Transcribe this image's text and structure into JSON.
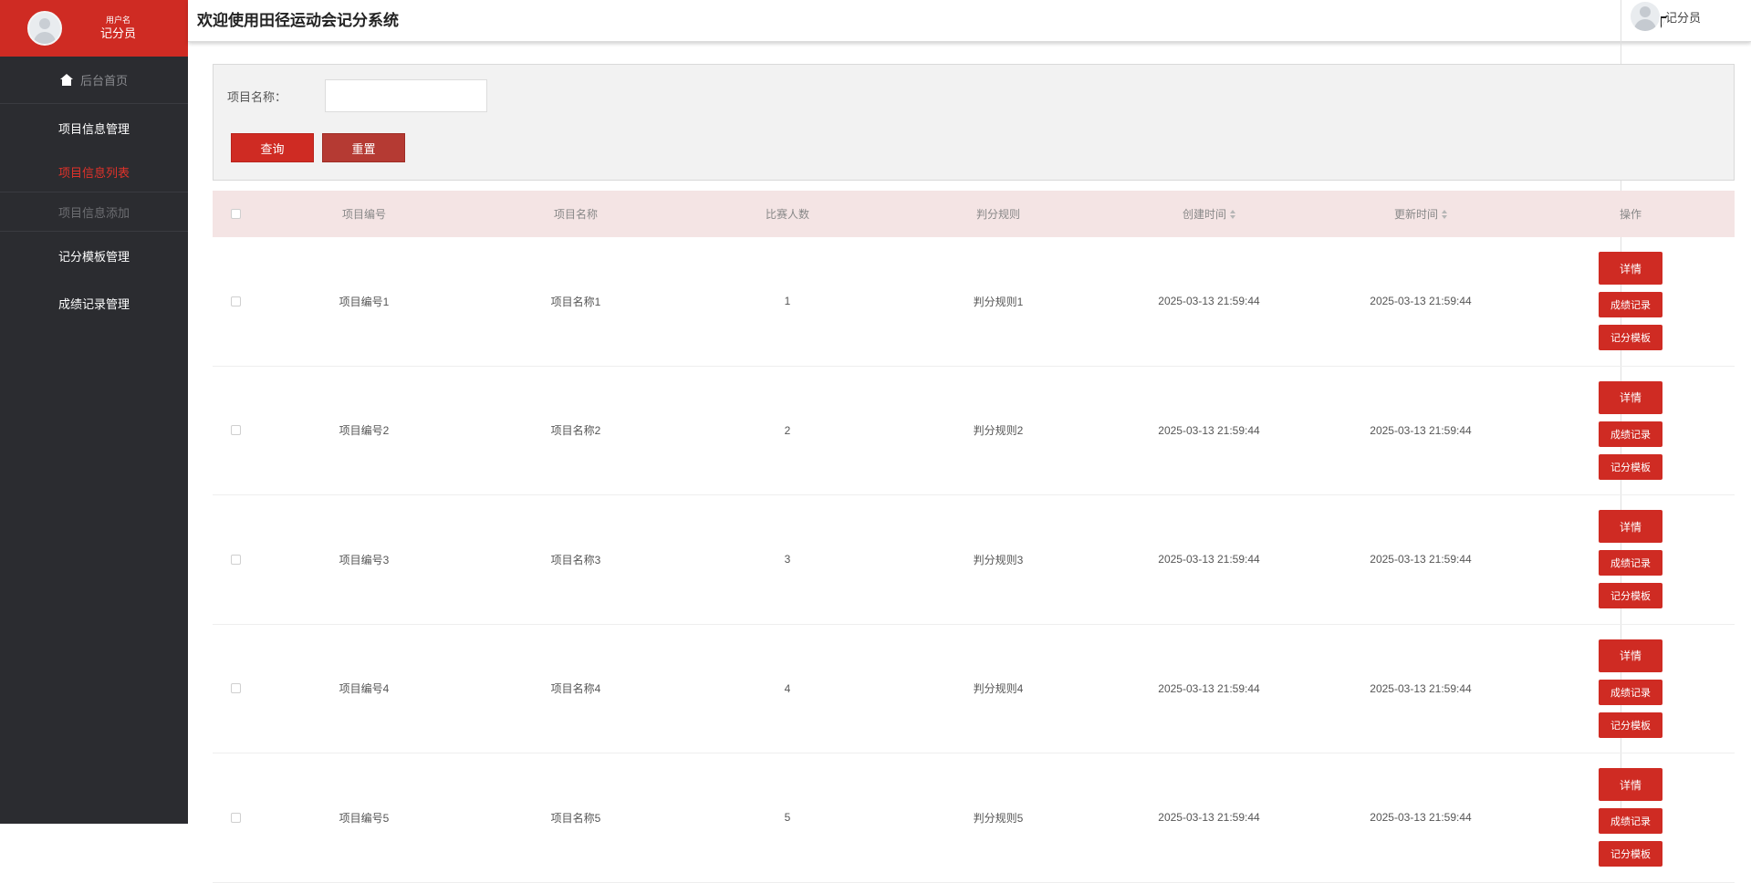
{
  "app": {
    "title": "欢迎使用田径运动会记分系统"
  },
  "sidebar": {
    "user_caption": "用户名",
    "user_role": "记分员",
    "home": "后台首页",
    "groups": [
      {
        "label": "项目信息管理",
        "items": [
          {
            "label": "项目信息列表",
            "active": true
          },
          {
            "label": "项目信息添加",
            "active": false
          }
        ]
      },
      {
        "label": "记分模板管理"
      },
      {
        "label": "成绩记录管理"
      }
    ]
  },
  "header": {
    "user_name": "记分员"
  },
  "search": {
    "label": "项目名称：",
    "value": "",
    "placeholder": "",
    "query_button": "查询",
    "reset_button": "重置"
  },
  "table": {
    "columns": [
      "项目编号",
      "项目名称",
      "比赛人数",
      "判分规则",
      "创建时间",
      "更新时间",
      "操作"
    ],
    "rows": [
      {
        "code": "项目编号1",
        "name": "项目名称1",
        "count": "1",
        "rule": "判分规则1",
        "created": "2025-03-13 21:59:44",
        "updated": "2025-03-13 21:59:44"
      },
      {
        "code": "项目编号2",
        "name": "项目名称2",
        "count": "2",
        "rule": "判分规则2",
        "created": "2025-03-13 21:59:44",
        "updated": "2025-03-13 21:59:44"
      },
      {
        "code": "项目编号3",
        "name": "项目名称3",
        "count": "3",
        "rule": "判分规则3",
        "created": "2025-03-13 21:59:44",
        "updated": "2025-03-13 21:59:44"
      },
      {
        "code": "项目编号4",
        "name": "项目名称4",
        "count": "4",
        "rule": "判分规则4",
        "created": "2025-03-13 21:59:44",
        "updated": "2025-03-13 21:59:44"
      },
      {
        "code": "项目编号5",
        "name": "项目名称5",
        "count": "5",
        "rule": "判分规则5",
        "created": "2025-03-13 21:59:44",
        "updated": "2025-03-13 21:59:44"
      }
    ],
    "actions": {
      "detail": "详情",
      "score_record": "成绩记录",
      "score_template": "记分模板"
    }
  },
  "colors": {
    "brand_red": "#cf2b23",
    "sidebar_bg": "#2b2c30",
    "table_header_bg": "#f4e4e4"
  }
}
